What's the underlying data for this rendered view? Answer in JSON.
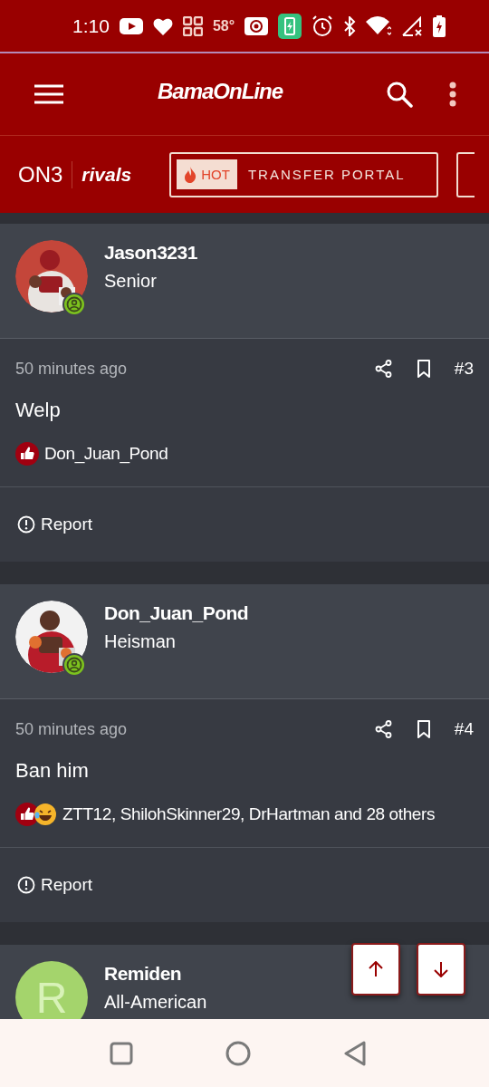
{
  "status_bar": {
    "time": "1:10",
    "temperature": "58°"
  },
  "header": {
    "logo": "BamaOnLine"
  },
  "nav": {
    "brand": "ON3",
    "partner": "rivals",
    "hot_badge": "HOT",
    "portal_button": "TRANSFER PORTAL"
  },
  "posts": [
    {
      "author": {
        "name": "Jason3231",
        "rank": "Senior",
        "online": true
      },
      "time": "50 minutes ago",
      "number": "#3",
      "text": "Welp",
      "reactions": [
        {
          "kind": "like"
        }
      ],
      "reacted_by": "Don_Juan_Pond",
      "report": "Report"
    },
    {
      "author": {
        "name": "Don_Juan_Pond",
        "rank": "Heisman",
        "online": true
      },
      "time": "50 minutes ago",
      "number": "#4",
      "text": "Ban him",
      "reactions": [
        {
          "kind": "like"
        },
        {
          "kind": "laugh"
        }
      ],
      "reacted_by": "ZTT12, ShilohSkinner29, DrHartman and 28 others",
      "report": "Report"
    },
    {
      "author": {
        "name": "Remiden",
        "rank": "All-American",
        "avatar": {
          "kind": "letter",
          "letter": "R"
        }
      }
    }
  ]
}
